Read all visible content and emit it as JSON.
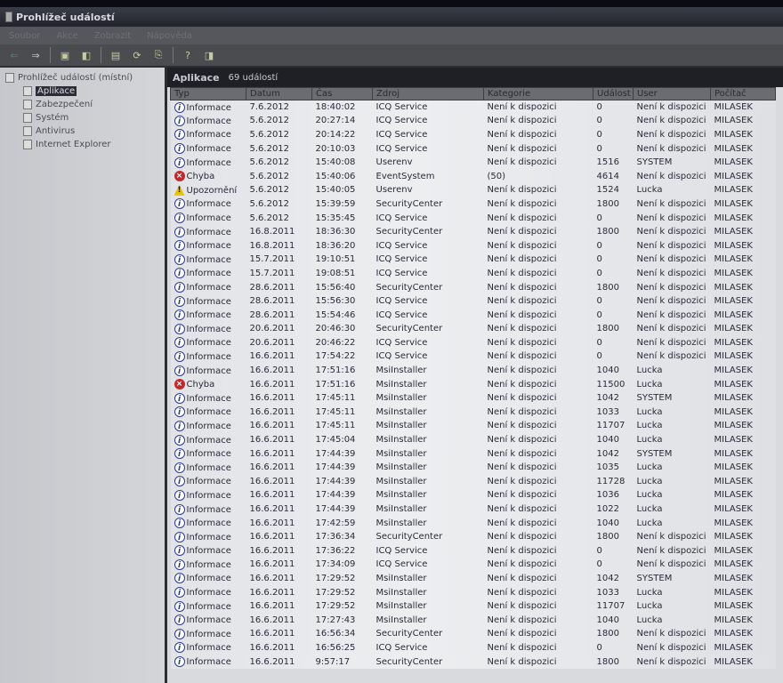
{
  "window": {
    "title": "Prohlížeč událostí"
  },
  "menu": [
    "Soubor",
    "Akce",
    "Zobrazit",
    "Nápověda"
  ],
  "tree": {
    "root": "Prohlížeč událostí (místní)",
    "items": [
      "Aplikace",
      "Zabezpečení",
      "Systém",
      "Antivirus",
      "Internet Explorer"
    ],
    "selected": "Aplikace"
  },
  "pane": {
    "title": "Aplikace",
    "count": "69 událostí"
  },
  "columns": [
    "Typ",
    "Datum",
    "Čas",
    "Zdroj",
    "Kategorie",
    "Událost",
    "User",
    "Počítač"
  ],
  "type_icons": {
    "Informace": "info-icon",
    "Chyba": "error-icon",
    "Upozornění": "warning-icon"
  },
  "rows": [
    [
      "Informace",
      "7.6.2012",
      "18:40:02",
      "ICQ Service",
      "Není k dispozici",
      "0",
      "Není k dispozici",
      "MILASEK"
    ],
    [
      "Informace",
      "5.6.2012",
      "20:27:14",
      "ICQ Service",
      "Není k dispozici",
      "0",
      "Není k dispozici",
      "MILASEK"
    ],
    [
      "Informace",
      "5.6.2012",
      "20:14:22",
      "ICQ Service",
      "Není k dispozici",
      "0",
      "Není k dispozici",
      "MILASEK"
    ],
    [
      "Informace",
      "5.6.2012",
      "20:10:03",
      "ICQ Service",
      "Není k dispozici",
      "0",
      "Není k dispozici",
      "MILASEK"
    ],
    [
      "Informace",
      "5.6.2012",
      "15:40:08",
      "Userenv",
      "Není k dispozici",
      "1516",
      "SYSTEM",
      "MILASEK"
    ],
    [
      "Chyba",
      "5.6.2012",
      "15:40:06",
      "EventSystem",
      "(50)",
      "4614",
      "Není k dispozici",
      "MILASEK"
    ],
    [
      "Upozornění",
      "5.6.2012",
      "15:40:05",
      "Userenv",
      "Není k dispozici",
      "1524",
      "Lucka",
      "MILASEK"
    ],
    [
      "Informace",
      "5.6.2012",
      "15:39:59",
      "SecurityCenter",
      "Není k dispozici",
      "1800",
      "Není k dispozici",
      "MILASEK"
    ],
    [
      "Informace",
      "5.6.2012",
      "15:35:45",
      "ICQ Service",
      "Není k dispozici",
      "0",
      "Není k dispozici",
      "MILASEK"
    ],
    [
      "Informace",
      "16.8.2011",
      "18:36:30",
      "SecurityCenter",
      "Není k dispozici",
      "1800",
      "Není k dispozici",
      "MILASEK"
    ],
    [
      "Informace",
      "16.8.2011",
      "18:36:20",
      "ICQ Service",
      "Není k dispozici",
      "0",
      "Není k dispozici",
      "MILASEK"
    ],
    [
      "Informace",
      "15.7.2011",
      "19:10:51",
      "ICQ Service",
      "Není k dispozici",
      "0",
      "Není k dispozici",
      "MILASEK"
    ],
    [
      "Informace",
      "15.7.2011",
      "19:08:51",
      "ICQ Service",
      "Není k dispozici",
      "0",
      "Není k dispozici",
      "MILASEK"
    ],
    [
      "Informace",
      "28.6.2011",
      "15:56:40",
      "SecurityCenter",
      "Není k dispozici",
      "1800",
      "Není k dispozici",
      "MILASEK"
    ],
    [
      "Informace",
      "28.6.2011",
      "15:56:30",
      "ICQ Service",
      "Není k dispozici",
      "0",
      "Není k dispozici",
      "MILASEK"
    ],
    [
      "Informace",
      "28.6.2011",
      "15:54:46",
      "ICQ Service",
      "Není k dispozici",
      "0",
      "Není k dispozici",
      "MILASEK"
    ],
    [
      "Informace",
      "20.6.2011",
      "20:46:30",
      "SecurityCenter",
      "Není k dispozici",
      "1800",
      "Není k dispozici",
      "MILASEK"
    ],
    [
      "Informace",
      "20.6.2011",
      "20:46:22",
      "ICQ Service",
      "Není k dispozici",
      "0",
      "Není k dispozici",
      "MILASEK"
    ],
    [
      "Informace",
      "16.6.2011",
      "17:54:22",
      "ICQ Service",
      "Není k dispozici",
      "0",
      "Není k dispozici",
      "MILASEK"
    ],
    [
      "Informace",
      "16.6.2011",
      "17:51:16",
      "MsiInstaller",
      "Není k dispozici",
      "1040",
      "Lucka",
      "MILASEK"
    ],
    [
      "Chyba",
      "16.6.2011",
      "17:51:16",
      "MsiInstaller",
      "Není k dispozici",
      "11500",
      "Lucka",
      "MILASEK"
    ],
    [
      "Informace",
      "16.6.2011",
      "17:45:11",
      "MsiInstaller",
      "Není k dispozici",
      "1042",
      "SYSTEM",
      "MILASEK"
    ],
    [
      "Informace",
      "16.6.2011",
      "17:45:11",
      "MsiInstaller",
      "Není k dispozici",
      "1033",
      "Lucka",
      "MILASEK"
    ],
    [
      "Informace",
      "16.6.2011",
      "17:45:11",
      "MsiInstaller",
      "Není k dispozici",
      "11707",
      "Lucka",
      "MILASEK"
    ],
    [
      "Informace",
      "16.6.2011",
      "17:45:04",
      "MsiInstaller",
      "Není k dispozici",
      "1040",
      "Lucka",
      "MILASEK"
    ],
    [
      "Informace",
      "16.6.2011",
      "17:44:39",
      "MsiInstaller",
      "Není k dispozici",
      "1042",
      "SYSTEM",
      "MILASEK"
    ],
    [
      "Informace",
      "16.6.2011",
      "17:44:39",
      "MsiInstaller",
      "Není k dispozici",
      "1035",
      "Lucka",
      "MILASEK"
    ],
    [
      "Informace",
      "16.6.2011",
      "17:44:39",
      "MsiInstaller",
      "Není k dispozici",
      "11728",
      "Lucka",
      "MILASEK"
    ],
    [
      "Informace",
      "16.6.2011",
      "17:44:39",
      "MsiInstaller",
      "Není k dispozici",
      "1036",
      "Lucka",
      "MILASEK"
    ],
    [
      "Informace",
      "16.6.2011",
      "17:44:39",
      "MsiInstaller",
      "Není k dispozici",
      "1022",
      "Lucka",
      "MILASEK"
    ],
    [
      "Informace",
      "16.6.2011",
      "17:42:59",
      "MsiInstaller",
      "Není k dispozici",
      "1040",
      "Lucka",
      "MILASEK"
    ],
    [
      "Informace",
      "16.6.2011",
      "17:36:34",
      "SecurityCenter",
      "Není k dispozici",
      "1800",
      "Není k dispozici",
      "MILASEK"
    ],
    [
      "Informace",
      "16.6.2011",
      "17:36:22",
      "ICQ Service",
      "Není k dispozici",
      "0",
      "Není k dispozici",
      "MILASEK"
    ],
    [
      "Informace",
      "16.6.2011",
      "17:34:09",
      "ICQ Service",
      "Není k dispozici",
      "0",
      "Není k dispozici",
      "MILASEK"
    ],
    [
      "Informace",
      "16.6.2011",
      "17:29:52",
      "MsiInstaller",
      "Není k dispozici",
      "1042",
      "SYSTEM",
      "MILASEK"
    ],
    [
      "Informace",
      "16.6.2011",
      "17:29:52",
      "MsiInstaller",
      "Není k dispozici",
      "1033",
      "Lucka",
      "MILASEK"
    ],
    [
      "Informace",
      "16.6.2011",
      "17:29:52",
      "MsiInstaller",
      "Není k dispozici",
      "11707",
      "Lucka",
      "MILASEK"
    ],
    [
      "Informace",
      "16.6.2011",
      "17:27:43",
      "MsiInstaller",
      "Není k dispozici",
      "1040",
      "Lucka",
      "MILASEK"
    ],
    [
      "Informace",
      "16.6.2011",
      "16:56:34",
      "SecurityCenter",
      "Není k dispozici",
      "1800",
      "Není k dispozici",
      "MILASEK"
    ],
    [
      "Informace",
      "16.6.2011",
      "16:56:25",
      "ICQ Service",
      "Není k dispozici",
      "0",
      "Není k dispozici",
      "MILASEK"
    ],
    [
      "Informace",
      "16.6.2011",
      "9:57:17",
      "SecurityCenter",
      "Není k dispozici",
      "1800",
      "Není k dispozici",
      "MILASEK"
    ]
  ]
}
